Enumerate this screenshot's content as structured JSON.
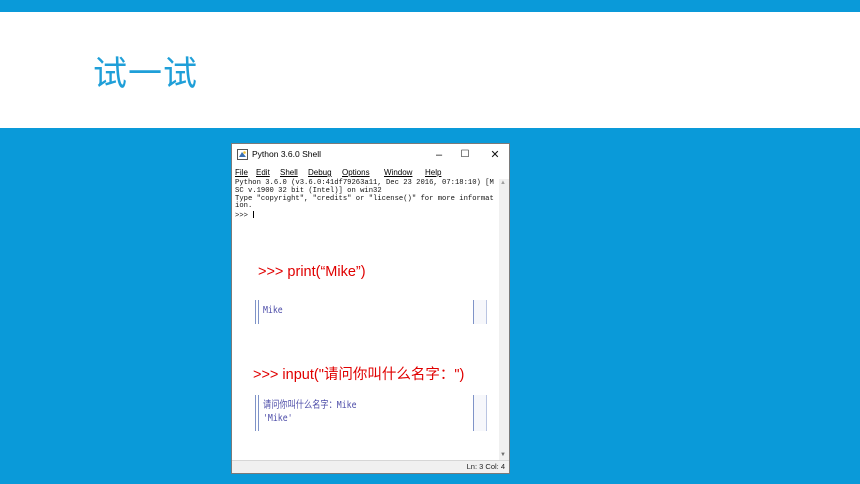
{
  "slide": {
    "title": "试一试"
  },
  "window": {
    "title": "Python 3.6.0 Shell",
    "controls": {
      "minimize": "–",
      "maximize": "☐",
      "close": "✕"
    },
    "menu": [
      "File",
      "Edit",
      "Shell",
      "Debug",
      "Options",
      "Window",
      "Help"
    ],
    "shell_text": "Python 3.6.0 (v3.6.0:41df79263a11, Dec 23 2016, 07:18:10) [MSC v.1900 32 bit (Intel)] on win32\nType \"copyright\", \"credits\" or \"license()\" for more information.\n>>> ",
    "status": "Ln: 3  Col: 4"
  },
  "examples": [
    {
      "code": ">>> print(“Mike”)",
      "output": "Mike"
    },
    {
      "code_prefix": ">>> input(\"",
      "code_cn": "请问你叫什么名字：",
      "code_suffix": "\")",
      "output_line1": "请问你叫什么名字：Mike",
      "output_line2": "'Mike'"
    }
  ],
  "colors": {
    "background": "#0a9ad9",
    "title": "#1f9fd8",
    "code": "#e00000",
    "output": "#4c4ca8"
  }
}
